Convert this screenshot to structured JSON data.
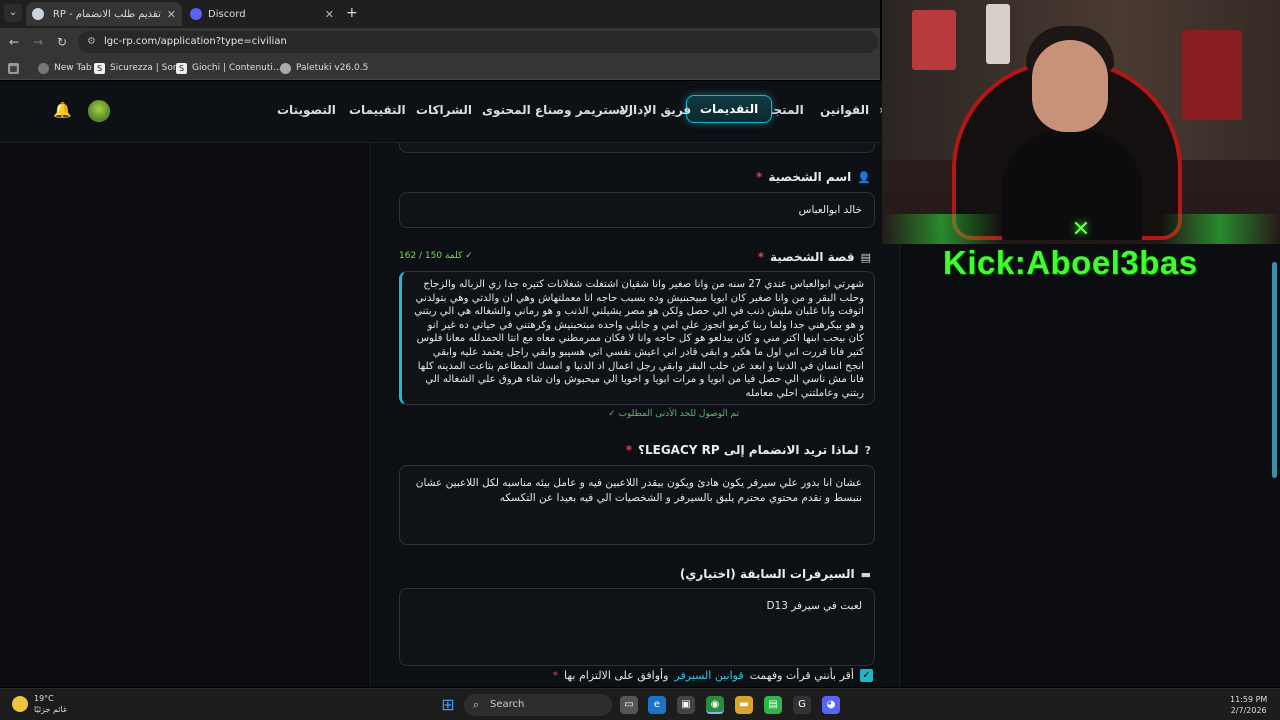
{
  "browser": {
    "tabs": [
      {
        "title": "تقديم طلب الانضمام - LEGACY RP",
        "active": true
      },
      {
        "title": "Discord",
        "active": false
      }
    ],
    "url": "lgc-rp.com/application?type=civilian",
    "bookmarks": [
      "New Tab",
      "Sicurezza | Sony",
      "Giochi | Contenuti...",
      "Paletuki v26.0.5"
    ]
  },
  "site": {
    "nav": [
      "القوانين",
      "المتجر",
      "التقديمات",
      "فريق الإدارة",
      "الاستريمر وصناع المحتوى",
      "الشراكات",
      "التقييمات",
      "التصويتات"
    ],
    "active_nav": "التقديمات"
  },
  "form": {
    "name_label": "اسم الشخصية",
    "name_value": "خالد ابوالعباس",
    "story_label": "قصة الشخصية",
    "story_counter": "162 / 150 كلمة ✓",
    "story_value": "شهرتي ابوالعباس  عندي 27 سنه من وانا صغير وانا شقيان اشتغلت شغلانات كتيره جدا زي الزباله والزجاج وحلب البقر  و من وانا صغير كان ابويا مبيحبنيش وده بسبب حاجه انا معملتهاش وهي ان والدتي وهي بتولدني اتوفت وانا غلبان مليش ذنب في الي حصل ولكن هو مصر يشيلني الذنب و هو رماني والشغاله هي الي ربتني و هو بيكرهني جدا  ولما ربنا كرمو اتجوز علي امي و جابلي واحده مبتحبنيش وكرهتني في حياتي ده غير انو كان بيحب ابنها  اكتر مني و كان بيدلعو هو كل حاجه وانا لا فكان ممرمطني معاه مع انتا الحمدلله معانا فلوس كتير فانا قررت اني اول ما هكبر و ابقي قادر اني اعيش نفسي اني هسيبو وابقي راجل يعتمد عليه وابقي انجح  انسان في الدنيا و ابعد عن  حلب البقر وابقي رجل اعمال اد الدنيا و امسك المطاعم بتاعت المدينه كلها فانا مش ناسي الي حصل فيا من ابويا و مرات ابويا و اخويا الي مبحبوش وان شاء هروق علي الشغاله الي ربتني وعاملتني احلي معامله",
    "story_min_ok": "✓ تم الوصول للحد الأدنى المطلوب",
    "why_label": "لماذا تريد الانضمام إلى LEGACY RP؟",
    "why_value": "عشان انا بدور علي سيرفر يكون هادئ ويكون بيقدر اللاعبين فيه و عامل بيئه مناسبه  لكل اللاعبين  عشان ننبسط و نقدم محتوي محترم يليق بالسيرفر  و الشخصيات الي فيه  بعيدا عن التكسكه",
    "prev_label": "السيرفرات السابقة (اختياري)",
    "prev_value": "لعبت في سيرفر D13",
    "agree_prefix": "أقر بأنني قرأت وفهمت",
    "agree_link": "قوانين السيرفر",
    "agree_suffix": "وأوافق على الالتزام بها",
    "required_mark": "*"
  },
  "overlay": {
    "kick_text": "Kick:Aboel3bas"
  },
  "taskbar": {
    "temp": "19°C",
    "weather": "غائم جزئيًا",
    "search": "Search",
    "time": "11:59 PM",
    "date": "2/7/2026"
  },
  "colors": {
    "accent": "#1fb5c9",
    "required": "#e0434a",
    "success": "#5db96a",
    "kick_green": "#3cff2b"
  }
}
